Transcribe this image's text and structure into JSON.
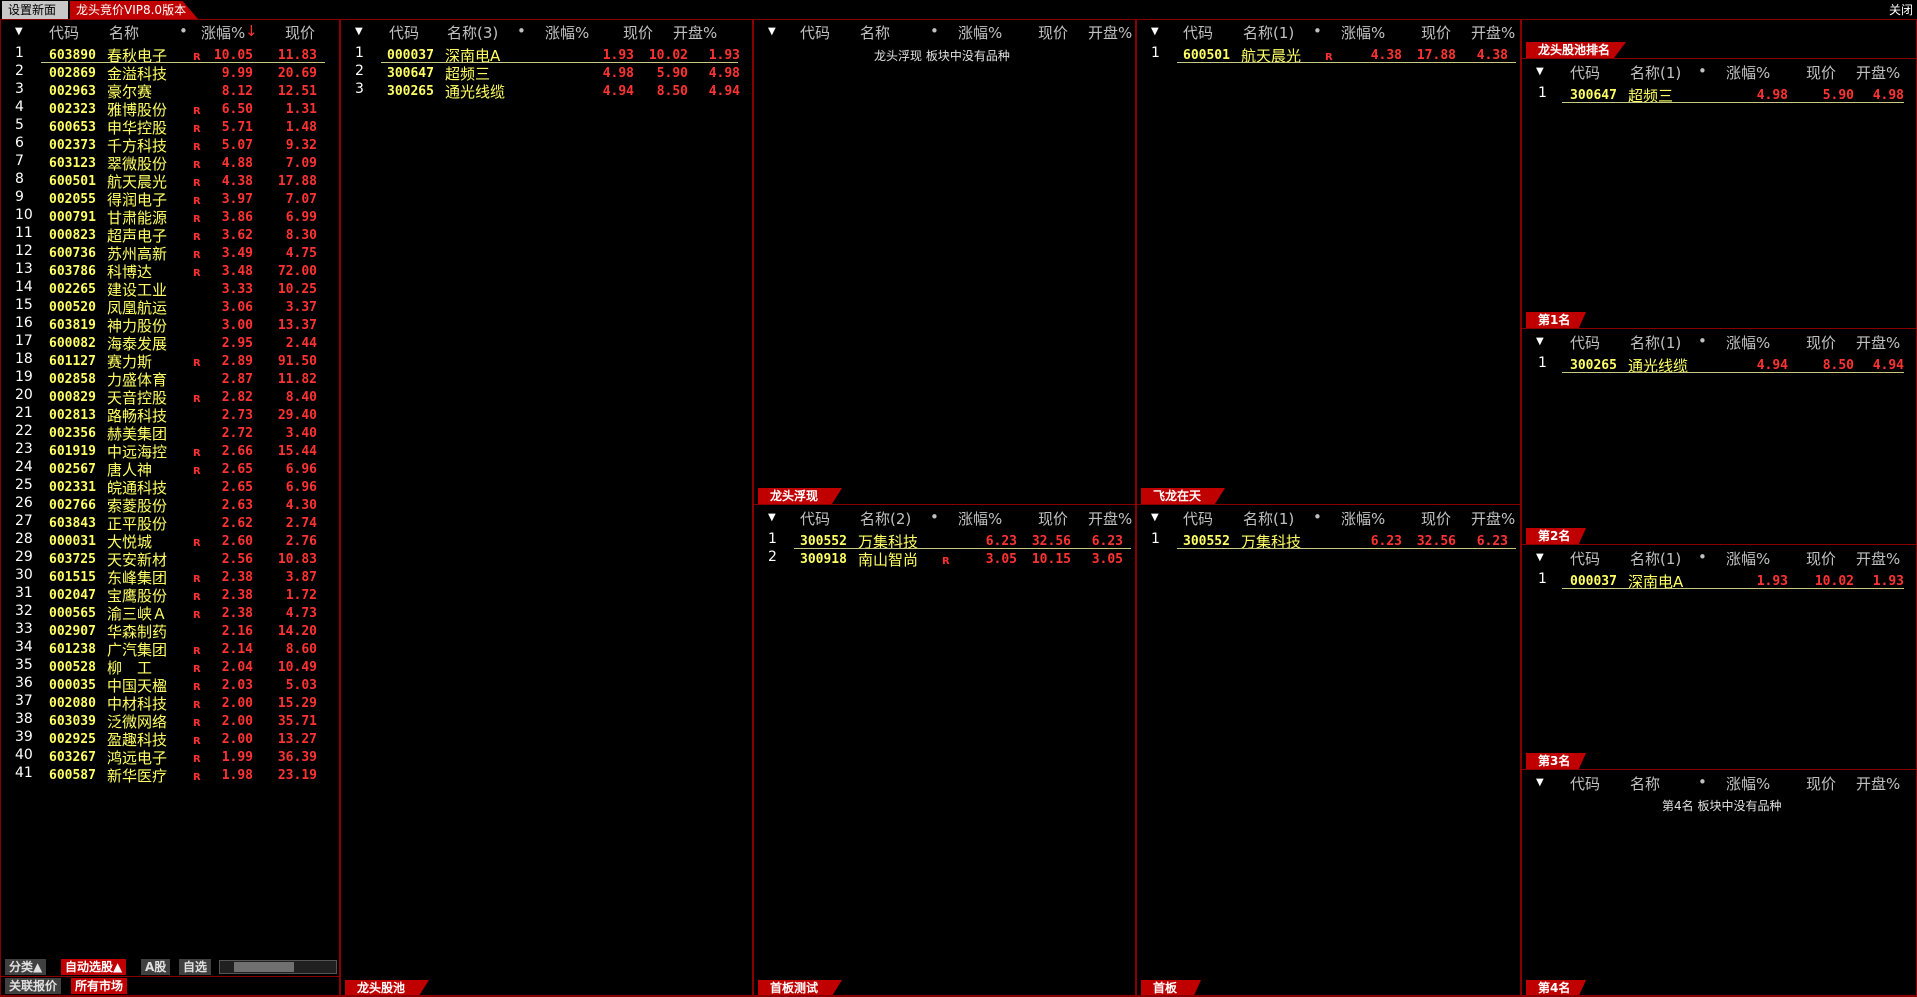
{
  "app": {
    "settings_tab": "设置新面",
    "active_tab": "龙头竞价VIP8.0版本",
    "close": "关闭"
  },
  "left_list": {
    "headers": {
      "caret": "▼",
      "code": "代码",
      "name": "名称",
      "dot": "•",
      "change": "涨幅%",
      "change_arrow": "↓",
      "price": "现价"
    },
    "rows": [
      {
        "i": "1",
        "code": "603890",
        "name": "春秋电子",
        "r": "R",
        "chg": "10.05",
        "price": "11.83"
      },
      {
        "i": "2",
        "code": "002869",
        "name": "金溢科技",
        "r": "",
        "chg": "9.99",
        "price": "20.69"
      },
      {
        "i": "3",
        "code": "002963",
        "name": "豪尔赛",
        "r": "",
        "chg": "8.12",
        "price": "12.51"
      },
      {
        "i": "4",
        "code": "002323",
        "name": "雅博股份",
        "r": "R",
        "chg": "6.50",
        "price": "1.31"
      },
      {
        "i": "5",
        "code": "600653",
        "name": "申华控股",
        "r": "R",
        "chg": "5.71",
        "price": "1.48"
      },
      {
        "i": "6",
        "code": "002373",
        "name": "千方科技",
        "r": "R",
        "chg": "5.07",
        "price": "9.32"
      },
      {
        "i": "7",
        "code": "603123",
        "name": "翠微股份",
        "r": "R",
        "chg": "4.88",
        "price": "7.09"
      },
      {
        "i": "8",
        "code": "600501",
        "name": "航天晨光",
        "r": "R",
        "chg": "4.38",
        "price": "17.88"
      },
      {
        "i": "9",
        "code": "002055",
        "name": "得润电子",
        "r": "R",
        "chg": "3.97",
        "price": "7.07"
      },
      {
        "i": "10",
        "code": "000791",
        "name": "甘肃能源",
        "r": "R",
        "chg": "3.86",
        "price": "6.99"
      },
      {
        "i": "11",
        "code": "000823",
        "name": "超声电子",
        "r": "R",
        "chg": "3.62",
        "price": "8.30"
      },
      {
        "i": "12",
        "code": "600736",
        "name": "苏州高新",
        "r": "R",
        "chg": "3.49",
        "price": "4.75"
      },
      {
        "i": "13",
        "code": "603786",
        "name": "科博达",
        "r": "R",
        "chg": "3.48",
        "price": "72.00"
      },
      {
        "i": "14",
        "code": "002265",
        "name": "建设工业",
        "r": "",
        "chg": "3.33",
        "price": "10.25"
      },
      {
        "i": "15",
        "code": "000520",
        "name": "凤凰航运",
        "r": "",
        "chg": "3.06",
        "price": "3.37"
      },
      {
        "i": "16",
        "code": "603819",
        "name": "神力股份",
        "r": "",
        "chg": "3.00",
        "price": "13.37"
      },
      {
        "i": "17",
        "code": "600082",
        "name": "海泰发展",
        "r": "",
        "chg": "2.95",
        "price": "2.44"
      },
      {
        "i": "18",
        "code": "601127",
        "name": "赛力斯",
        "r": "R",
        "chg": "2.89",
        "price": "91.50"
      },
      {
        "i": "19",
        "code": "002858",
        "name": "力盛体育",
        "r": "",
        "chg": "2.87",
        "price": "11.82"
      },
      {
        "i": "20",
        "code": "000829",
        "name": "天音控股",
        "r": "R",
        "chg": "2.82",
        "price": "8.40"
      },
      {
        "i": "21",
        "code": "002813",
        "name": "路畅科技",
        "r": "",
        "chg": "2.73",
        "price": "29.40"
      },
      {
        "i": "22",
        "code": "002356",
        "name": "赫美集团",
        "r": "",
        "chg": "2.72",
        "price": "3.40"
      },
      {
        "i": "23",
        "code": "601919",
        "name": "中远海控",
        "r": "R",
        "chg": "2.66",
        "price": "15.44"
      },
      {
        "i": "24",
        "code": "002567",
        "name": "唐人神",
        "r": "R",
        "chg": "2.65",
        "price": "6.96"
      },
      {
        "i": "25",
        "code": "002331",
        "name": "皖通科技",
        "r": "",
        "chg": "2.65",
        "price": "6.96"
      },
      {
        "i": "26",
        "code": "002766",
        "name": "索菱股份",
        "r": "",
        "chg": "2.63",
        "price": "4.30"
      },
      {
        "i": "27",
        "code": "603843",
        "name": "正平股份",
        "r": "",
        "chg": "2.62",
        "price": "2.74"
      },
      {
        "i": "28",
        "code": "000031",
        "name": "大悦城",
        "r": "R",
        "chg": "2.60",
        "price": "2.76"
      },
      {
        "i": "29",
        "code": "603725",
        "name": "天安新材",
        "r": "",
        "chg": "2.56",
        "price": "10.83"
      },
      {
        "i": "30",
        "code": "601515",
        "name": "东峰集团",
        "r": "R",
        "chg": "2.38",
        "price": "3.87"
      },
      {
        "i": "31",
        "code": "002047",
        "name": "宝鹰股份",
        "r": "R",
        "chg": "2.38",
        "price": "1.72"
      },
      {
        "i": "32",
        "code": "000565",
        "name": "渝三峡Ａ",
        "r": "R",
        "chg": "2.38",
        "price": "4.73"
      },
      {
        "i": "33",
        "code": "002907",
        "name": "华森制药",
        "r": "",
        "chg": "2.16",
        "price": "14.20"
      },
      {
        "i": "34",
        "code": "601238",
        "name": "广汽集团",
        "r": "R",
        "chg": "2.14",
        "price": "8.60"
      },
      {
        "i": "35",
        "code": "000528",
        "name": "柳　工",
        "r": "R",
        "chg": "2.04",
        "price": "10.49"
      },
      {
        "i": "36",
        "code": "000035",
        "name": "中国天楹",
        "r": "R",
        "chg": "2.03",
        "price": "5.03"
      },
      {
        "i": "37",
        "code": "002080",
        "name": "中材科技",
        "r": "R",
        "chg": "2.00",
        "price": "15.29"
      },
      {
        "i": "38",
        "code": "603039",
        "name": "泛微网络",
        "r": "R",
        "chg": "2.00",
        "price": "35.71"
      },
      {
        "i": "39",
        "code": "002925",
        "name": "盈趣科技",
        "r": "R",
        "chg": "2.00",
        "price": "13.27"
      },
      {
        "i": "40",
        "code": "603267",
        "name": "鸿远电子",
        "r": "R",
        "chg": "1.99",
        "price": "36.39"
      },
      {
        "i": "41",
        "code": "600587",
        "name": "新华医疗",
        "r": "R",
        "chg": "1.98",
        "price": "23.19"
      }
    ],
    "bottom_tabs": {
      "category": "分类▲",
      "auto": "自动选股▲",
      "a_share": "A股",
      "custom": "自选",
      "related": "关联报价",
      "all_market": "所有市场"
    }
  },
  "p2": {
    "headers": {
      "code": "代码",
      "name": "名称(3)",
      "dot": "•",
      "change": "涨幅%",
      "price": "现价",
      "open": "开盘%"
    },
    "rows": [
      {
        "i": "1",
        "code": "000037",
        "name": "深南电A",
        "r": "",
        "chg": "1.93",
        "price": "10.02",
        "open": "1.93"
      },
      {
        "i": "2",
        "code": "300647",
        "name": "超频三",
        "r": "",
        "chg": "4.98",
        "price": "5.90",
        "open": "4.98"
      },
      {
        "i": "3",
        "code": "300265",
        "name": "通光线缆",
        "r": "",
        "chg": "4.94",
        "price": "8.50",
        "open": "4.94"
      }
    ],
    "label": "龙头股池"
  },
  "p3": {
    "top_headers": {
      "code": "代码",
      "name": "名称",
      "dot": "•",
      "change": "涨幅%",
      "price": "现价",
      "open": "开盘%"
    },
    "empty": "龙头浮现 板块中没有品种",
    "top_label": "龙头浮现",
    "bottom_headers": {
      "code": "代码",
      "name": "名称(2)",
      "dot": "•",
      "change": "涨幅%",
      "price": "现价",
      "open": "开盘%"
    },
    "bottom_rows": [
      {
        "i": "1",
        "code": "300552",
        "name": "万集科技",
        "r": "",
        "chg": "6.23",
        "price": "32.56",
        "open": "6.23"
      },
      {
        "i": "2",
        "code": "300918",
        "name": "南山智尚",
        "r": "R",
        "chg": "3.05",
        "price": "10.15",
        "open": "3.05"
      }
    ],
    "bottom_label": "首板测试"
  },
  "p4": {
    "top_headers": {
      "code": "代码",
      "name": "名称(1)",
      "dot": "•",
      "change": "涨幅%",
      "price": "现价",
      "open": "开盘%"
    },
    "top_rows": [
      {
        "i": "1",
        "code": "600501",
        "name": "航天晨光",
        "r": "R",
        "chg": "4.38",
        "price": "17.88",
        "open": "4.38"
      }
    ],
    "top_label": "飞龙在天",
    "bottom_headers": {
      "code": "代码",
      "name": "名称(1)",
      "dot": "•",
      "change": "涨幅%",
      "price": "现价",
      "open": "开盘%"
    },
    "bottom_rows": [
      {
        "i": "1",
        "code": "300552",
        "name": "万集科技",
        "r": "",
        "chg": "6.23",
        "price": "32.56",
        "open": "6.23"
      }
    ],
    "bottom_label": "首板"
  },
  "p5": {
    "title_label": "龙头股池排名",
    "s1": {
      "headers": {
        "code": "代码",
        "name": "名称(1)",
        "dot": "•",
        "change": "涨幅%",
        "price": "现价",
        "open": "开盘%"
      },
      "rows": [
        {
          "i": "1",
          "code": "300647",
          "name": "超频三",
          "r": "",
          "chg": "4.98",
          "price": "5.90",
          "open": "4.98"
        }
      ],
      "label": "第1名"
    },
    "s2": {
      "headers": {
        "code": "代码",
        "name": "名称(1)",
        "dot": "•",
        "change": "涨幅%",
        "price": "现价",
        "open": "开盘%"
      },
      "rows": [
        {
          "i": "1",
          "code": "300265",
          "name": "通光线缆",
          "r": "",
          "chg": "4.94",
          "price": "8.50",
          "open": "4.94"
        }
      ],
      "label": "第2名"
    },
    "s3": {
      "headers": {
        "code": "代码",
        "name": "名称(1)",
        "dot": "•",
        "change": "涨幅%",
        "price": "现价",
        "open": "开盘%"
      },
      "rows": [
        {
          "i": "1",
          "code": "000037",
          "name": "深南电A",
          "r": "",
          "chg": "1.93",
          "price": "10.02",
          "open": "1.93"
        }
      ],
      "label": "第3名"
    },
    "s4": {
      "headers": {
        "code": "代码",
        "name": "名称",
        "dot": "•",
        "change": "涨幅%",
        "price": "现价",
        "open": "开盘%"
      },
      "empty": "第4名 板块中没有品种",
      "label": "第4名"
    }
  },
  "colors": {
    "accent_red": "#c00000",
    "up_red": "#ff3333",
    "code_yellow": "#ffff66",
    "border": "#8a0000"
  }
}
